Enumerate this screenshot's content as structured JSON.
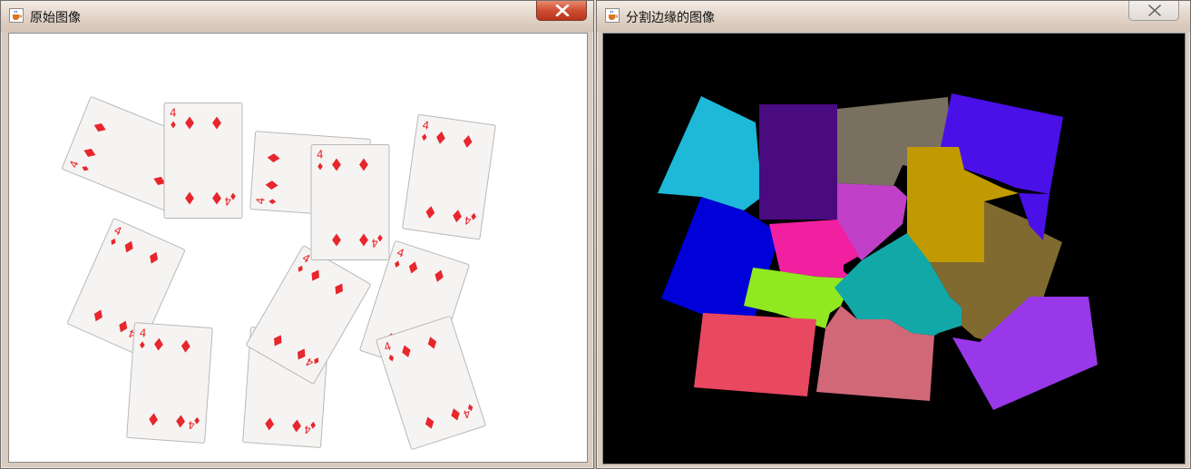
{
  "windows": {
    "original": {
      "title": "原始图像",
      "icon": "java-coffee-icon",
      "close_icon": "close-x-icon"
    },
    "segmented": {
      "title": "分割边缘的图像",
      "icon": "java-coffee-icon",
      "close_icon": "close-x-icon"
    }
  },
  "original_image": {
    "card_label": "4",
    "card_face": "#f6f4f2",
    "card_border": "#b8b8b8",
    "pip_color": "#e8262d"
  },
  "segmented_image": {
    "background": "#000000",
    "region_colors": [
      "#1eb8d8",
      "#4a0a80",
      "#7a7060",
      "#4a10e8",
      "#c040c8",
      "#c09a00",
      "#0000d8",
      "#f020a0",
      "#90e820",
      "#12a8a8",
      "#806a30",
      "#e84860",
      "#d06878",
      "#9838e8"
    ]
  }
}
